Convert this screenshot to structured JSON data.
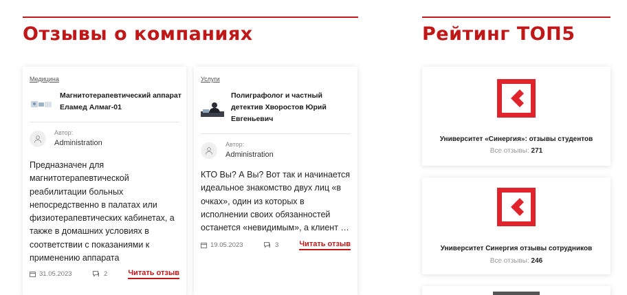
{
  "reviews_section": {
    "title": "Отзывы о компаниях",
    "cards": [
      {
        "category": "Медицина",
        "title": "Магнитотерапевтический аппарат Еламед Алмаг-01",
        "author_caption": "Автор:",
        "author_name": "Administration",
        "excerpt": "Предназначен для магнитотерапевтической реабилитации больных непосредственно в палатах или физиотерапевтических кабинетах, а также в домашних условиях в соответствии с показаниями к применению аппарата",
        "date": "31.05.2023",
        "comments": "2",
        "read_label": "Читать отзыв"
      },
      {
        "category": "Услуги",
        "title": "Полиграфолог и частный детектив Хворостов Юрий Евгеньевич",
        "author_caption": "Автор:",
        "author_name": "Administration",
        "excerpt": "КТО Вы? А Вы? Вот так и начинается идеальное знакомство двух лиц «в очках», один из которых в исполнении своих обязанностей останется «невидимым», а клиент …",
        "date": "19.05.2023",
        "comments": "3",
        "read_label": "Читать отзыв"
      }
    ]
  },
  "rating_section": {
    "title": "Рейтинг ТОП5",
    "items": [
      {
        "name": "Университет «Синергия»: отзывы студентов",
        "count_label": "Все отзывы:",
        "count": "271"
      },
      {
        "name": "Университет Синергия отзывы сотрудников",
        "count_label": "Все отзывы:",
        "count": "246"
      }
    ]
  },
  "colors": {
    "accent": "#c01818",
    "logo_red": "#e0242d"
  },
  "icons": {
    "avatar": "user-icon",
    "date": "calendar-icon",
    "comments": "comment-icon",
    "logo": "synergy-logo"
  }
}
